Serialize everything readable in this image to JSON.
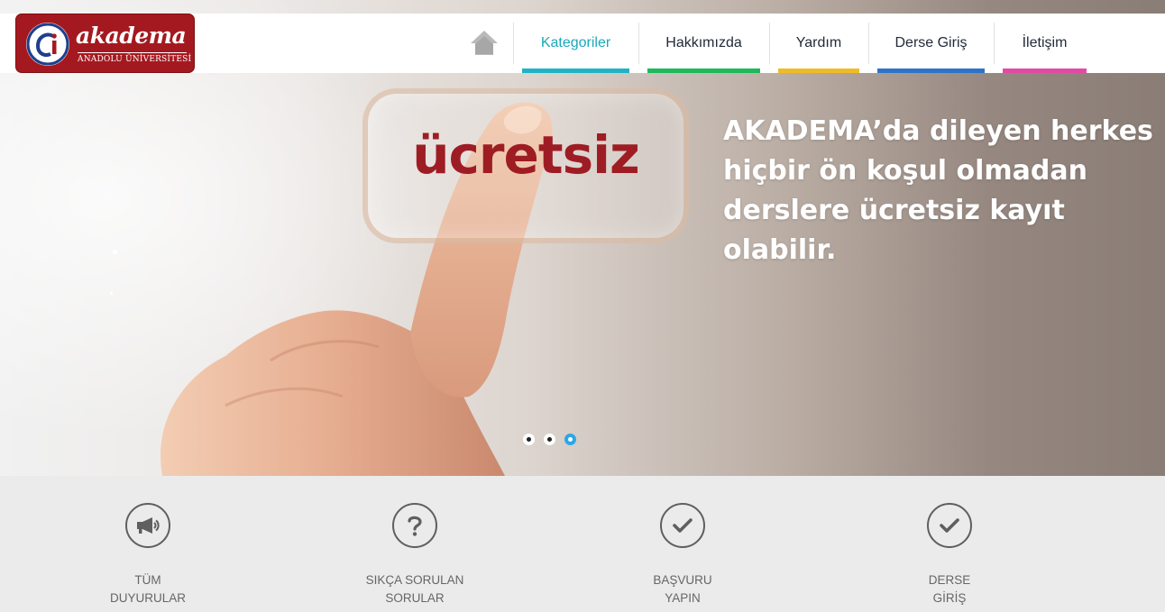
{
  "logo": {
    "name": "akadema",
    "subtitle": "ANADOLU ÜNİVERSİTESİ",
    "mark": "ai"
  },
  "nav": {
    "home_icon": "home-icon",
    "items": [
      {
        "label": "Kategoriler",
        "color": "#1fb3c4",
        "active": true
      },
      {
        "label": "Hakkımızda",
        "color": "#1db95a",
        "active": false
      },
      {
        "label": "Yardım",
        "color": "#f0bc26",
        "active": false
      },
      {
        "label": "Derse Giriş",
        "color": "#2f73c9",
        "active": false
      },
      {
        "label": "İletişim",
        "color": "#e24aa6",
        "active": false
      }
    ]
  },
  "hero": {
    "word": "ücretsiz",
    "lines": [
      "AKADEMA’da dileyen herkes",
      "hiçbir ön koşul olmadan",
      "derslere ücretsiz kayıt olabilir."
    ],
    "slides": 3,
    "active_slide": 3
  },
  "features": [
    {
      "icon": "megaphone-icon",
      "line1": "TÜM",
      "line2": "DUYURULAR"
    },
    {
      "icon": "question-icon",
      "line1": "SIKÇA SORULAN",
      "line2": "SORULAR"
    },
    {
      "icon": "check-icon",
      "line1": "BAŞVURU",
      "line2": "YAPIN"
    },
    {
      "icon": "check-icon",
      "line1": "DERSE",
      "line2": "GİRİŞ"
    }
  ],
  "colors": {
    "brand": "#a4191f",
    "hero_word": "#9e1d24",
    "slider_active": "#2aa7e8"
  }
}
